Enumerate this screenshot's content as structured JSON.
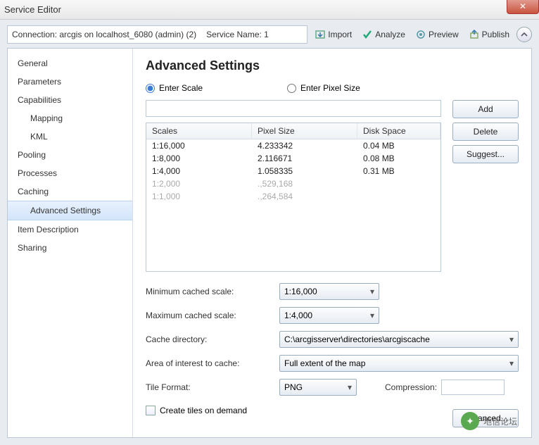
{
  "window": {
    "title": "Service Editor"
  },
  "connection": {
    "text": "Connection: arcgis on localhost_6080 (admin) (2)",
    "service_label": "Service Name: 1"
  },
  "toolbar": {
    "import": "Import",
    "analyze": "Analyze",
    "preview": "Preview",
    "publish": "Publish"
  },
  "sidebar": {
    "items": [
      {
        "label": "General"
      },
      {
        "label": "Parameters"
      },
      {
        "label": "Capabilities"
      },
      {
        "label": "Mapping",
        "sub": true
      },
      {
        "label": "KML",
        "sub": true
      },
      {
        "label": "Pooling"
      },
      {
        "label": "Processes"
      },
      {
        "label": "Caching"
      },
      {
        "label": "Advanced Settings",
        "sub": true,
        "selected": true
      },
      {
        "label": "Item Description"
      },
      {
        "label": "Sharing"
      }
    ]
  },
  "content": {
    "heading": "Advanced Settings",
    "radios": {
      "scale": "Enter Scale",
      "pixel": "Enter Pixel Size"
    },
    "buttons": {
      "add": "Add",
      "delete": "Delete",
      "suggest": "Suggest...",
      "advanced": "Advanced..."
    },
    "table": {
      "headers": {
        "scale": "Scales",
        "pixel": "Pixel Size",
        "disk": "Disk Space"
      },
      "rows": [
        {
          "scale": "1:16,000",
          "pixel": "4.233342",
          "disk": "0.04 MB"
        },
        {
          "scale": "1:8,000",
          "pixel": "2.116671",
          "disk": "0.08 MB"
        },
        {
          "scale": "1:4,000",
          "pixel": "1.058335",
          "disk": "0.31 MB"
        },
        {
          "scale": "1:2,000",
          "pixel": ".,529,168",
          "disk": "",
          "disabled": true
        },
        {
          "scale": "1:1,000",
          "pixel": ".,264,584",
          "disk": "",
          "disabled": true
        }
      ]
    },
    "form": {
      "min_label": "Minimum cached scale:",
      "min_value": "1:16,000",
      "max_label": "Maximum cached scale:",
      "max_value": "1:4,000",
      "dir_label": "Cache directory:",
      "dir_value": "C:\\arcgisserver\\directories\\arcgiscache",
      "aoi_label": "Area of interest to cache:",
      "aoi_value": "Full extent of the map",
      "fmt_label": "Tile Format:",
      "fmt_value": "PNG",
      "comp_label": "Compression:",
      "comp_value": "",
      "ondemand": "Create tiles on demand"
    }
  },
  "watermark": "地信论坛"
}
